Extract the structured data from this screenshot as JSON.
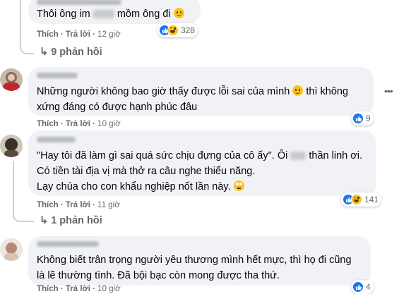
{
  "comments": [
    {
      "text_line1_before": "Thôi ông im",
      "text_line1_after": "mồm ông đi",
      "like_label": "Thích",
      "reply_label": "Trả lời",
      "time": "12 giờ",
      "reaction_count": "328",
      "replies_label": "9 phản hồi"
    },
    {
      "text_line1": "Những người không bao giờ thấy được lỗi sai của mình",
      "text_line1_after": "thì không",
      "text_line2": "xứng đáng có được hạnh phúc đâu",
      "like_label": "Thích",
      "reply_label": "Trả lời",
      "time": "10 giờ",
      "reaction_count": "9"
    },
    {
      "text_line1_before": "\"Hay tôi đã làm gì sai quá sức chịu đựng của cô ấy\". Ôi",
      "text_line1_after": "thần linh ơi.",
      "text_line2": "Có tiền tài địa vị mà thở ra câu nghe thiểu năng.",
      "text_line3": "Lạy chúa cho con khẩu nghiệp nốt lần này.",
      "like_label": "Thích",
      "reply_label": "Trả lời",
      "time": "11 giờ",
      "reaction_count": "141",
      "replies_label": "1 phản hồi"
    },
    {
      "text_line1": "Không biết trân trọng người yêu thương mình hết mực, thì họ đi cũng",
      "text_line2": "là lẽ thường tình. Đã bội bạc còn mong được tha thứ.",
      "like_label": "Thích",
      "reply_label": "Trả lời",
      "time": "10 giờ",
      "reaction_count": "4"
    }
  ],
  "icons": {
    "more": "more-horizontal-icon",
    "like": "like-reaction-icon",
    "haha": "haha-reaction-icon",
    "thread": "reply-thread-connector"
  },
  "colors": {
    "bubble": "#f0f2f5",
    "secondary_text": "#65676b",
    "like_blue": "#1877f2",
    "emoji_yellow": "#f7c325"
  }
}
